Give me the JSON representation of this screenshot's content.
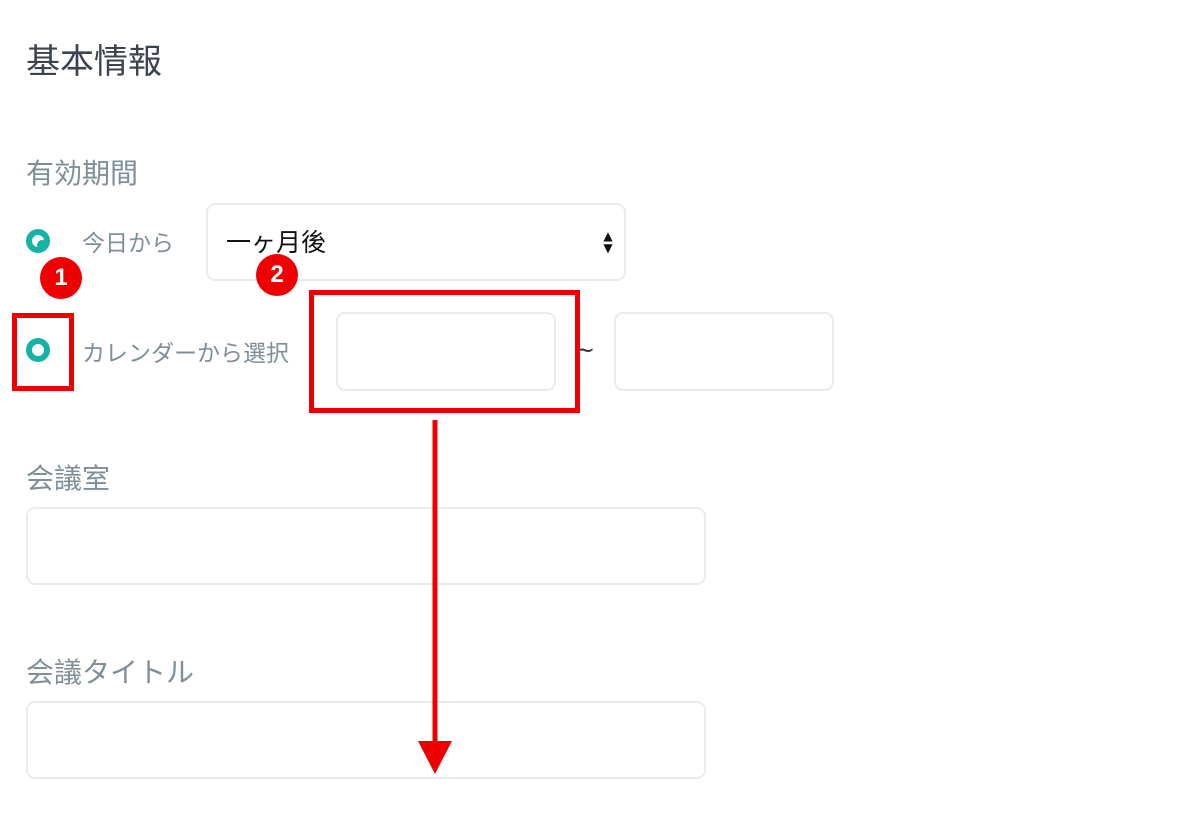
{
  "form": {
    "section_title": "基本情報",
    "validity": {
      "label": "有効期間",
      "option_today": {
        "label": "今日から",
        "selected": true
      },
      "duration_select": {
        "value": "一ヶ月後"
      },
      "option_calendar": {
        "label": "カレンダーから選択",
        "selected": false
      },
      "date_separator": "~",
      "start_date": {
        "value": "",
        "placeholder": ""
      },
      "end_date": {
        "value": "",
        "placeholder": ""
      }
    },
    "room": {
      "label": "会議室",
      "value": "",
      "placeholder": ""
    },
    "meeting_title": {
      "label": "会議タイトル",
      "value": "",
      "placeholder": ""
    }
  },
  "annotations": {
    "badge_1": "1",
    "badge_2": "2",
    "color": "#ee0000"
  },
  "colors": {
    "accent": "#14b3a3",
    "label": "#7e8f97",
    "heading": "#3c4250",
    "border": "#e9ecef"
  }
}
